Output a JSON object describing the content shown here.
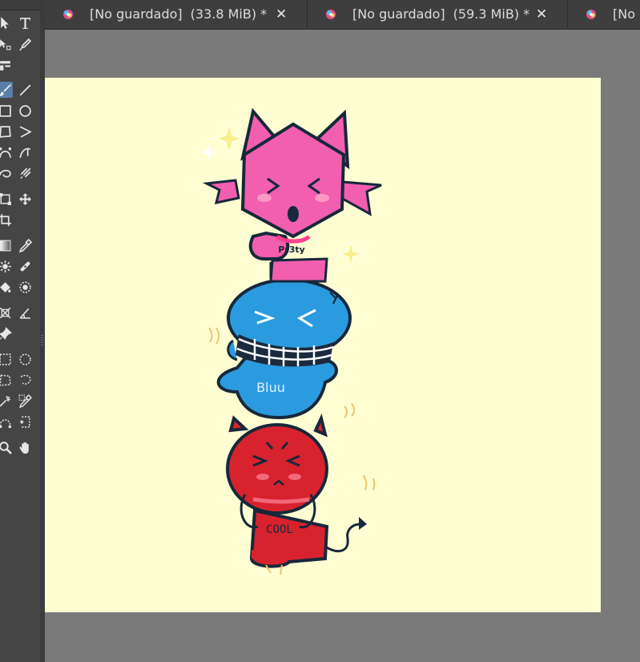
{
  "app": {
    "canvas_color": "#fffdd2",
    "workspace_color": "#7a7a7a",
    "accent": "#5b7ea8"
  },
  "tabs": [
    {
      "name": "[No guardado]",
      "size": "(33.8 MiB) *",
      "close": "✕",
      "icon": "image-icon"
    },
    {
      "name": "[No guardado]",
      "size": "(59.3 MiB) *",
      "close": "✕",
      "icon": "image-icon"
    },
    {
      "name": "[No g",
      "size": "",
      "close": "",
      "icon": "image-icon"
    }
  ],
  "tools": [
    "move-tool",
    "text-tool",
    "vector-select-tool",
    "calligraphy-tool",
    "fill-vector-tool",
    "brush-tool",
    "line-tool",
    "rectangle-tool",
    "ellipse-tool",
    "polygon-tool",
    "polyline-tool",
    "bezier-tool",
    "freehand-path-tool",
    "dynamic-brush-tool",
    "multibrush-tool",
    "transform-tool",
    "move-layer-tool",
    "crop-tool",
    "gradient-tool",
    "color-picker-tool",
    "colorize-mask-tool",
    "smart-patch-tool",
    "fill-tool",
    "enclose-fill-tool",
    "assistant-tool",
    "measure-tool",
    "reference-image-tool",
    "rect-select-tool",
    "ellipse-select-tool",
    "polygon-select-tool",
    "freehand-select-tool",
    "contiguous-select-tool",
    "similar-select-tool",
    "bezier-select-tool",
    "magnetic-select-tool",
    "zoom-tool",
    "pan-tool"
  ],
  "artwork": {
    "top_character_text": "Pr3ty",
    "middle_character_text": "Bluu",
    "bottom_character_text": "COOL",
    "colors": {
      "pink": "#f25fae",
      "blue": "#2b9be0",
      "red": "#d8232e",
      "outline": "#16283a",
      "sparkle": "#f8ef8a"
    }
  }
}
